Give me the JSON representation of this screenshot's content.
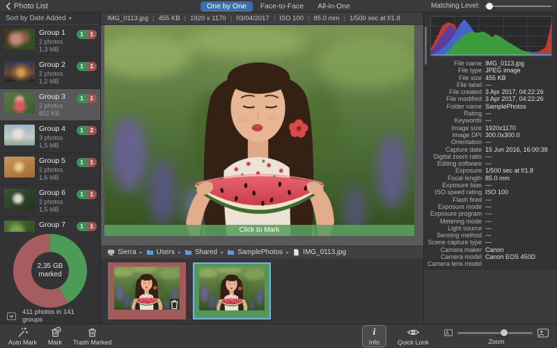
{
  "titlebar": {
    "back_label": "Photo List",
    "tabs": [
      {
        "label": "One by One",
        "active": true
      },
      {
        "label": "Face-to-Face",
        "active": false
      },
      {
        "label": "All-in-One",
        "active": false
      }
    ],
    "matching_level_label": "Matching Level:",
    "matching_level_pct": 7
  },
  "sidebar": {
    "sort_label": "Sort by Date Added",
    "groups": [
      {
        "name": "Group 1",
        "count": "2 photos",
        "size": "1,3 MB",
        "kept": "1",
        "marked": "1",
        "thumb": "g1",
        "selected": false
      },
      {
        "name": "Group 2",
        "count": "2 photos",
        "size": "1,2 MB",
        "kept": "1",
        "marked": "1",
        "thumb": "g2",
        "selected": false
      },
      {
        "name": "Group 3",
        "count": "2 photos",
        "size": "832 KB",
        "kept": "1",
        "marked": "1",
        "thumb": "g3",
        "selected": true
      },
      {
        "name": "Group 4",
        "count": "3 photos",
        "size": "1,5 MB",
        "kept": "1",
        "marked": "2",
        "thumb": "g4",
        "selected": false
      },
      {
        "name": "Group 5",
        "count": "2 photos",
        "size": "1,6 MB",
        "kept": "1",
        "marked": "1",
        "thumb": "g5",
        "selected": false
      },
      {
        "name": "Group 6",
        "count": "2 photos",
        "size": "1,5 MB",
        "kept": "1",
        "marked": "1",
        "thumb": "g6",
        "selected": false
      },
      {
        "name": "Group 7",
        "count": "",
        "size": "",
        "kept": "1",
        "marked": "1",
        "thumb": "g7",
        "selected": false
      }
    ],
    "summary": {
      "center_top": "2,35 GB",
      "center_bottom": "marked",
      "kept_pct": 42,
      "footer": "411 photos in 141 groups"
    }
  },
  "viewer": {
    "info_segments": [
      "IMG_0113.jpg",
      "455 KB",
      "1920 x 1170",
      "03/04/2017",
      "ISO 100",
      "85.0 mm",
      "1/500 sec at f/1.8"
    ],
    "click_to_mark": "Click to Mark",
    "breadcrumb": [
      {
        "icon": "computer-icon",
        "label": "Sierra"
      },
      {
        "icon": "folder-icon",
        "label": "Users"
      },
      {
        "icon": "folder-icon",
        "label": "Shared"
      },
      {
        "icon": "folder-icon",
        "label": "SamplePhotos"
      },
      {
        "icon": "file-icon",
        "label": "IMG_0113.jpg"
      }
    ]
  },
  "details": {
    "rows": [
      {
        "label": "File name",
        "value": "IMG_0113.jpg"
      },
      {
        "label": "File type",
        "value": "JPEG image"
      },
      {
        "label": "File size",
        "value": "455 KB"
      },
      {
        "label": "File label",
        "value": "---"
      },
      {
        "label": "File created",
        "value": "3 Apr 2017, 04:22:26"
      },
      {
        "label": "File modified",
        "value": "3 Apr 2017, 04:22:26"
      },
      {
        "label": "Folder name",
        "value": "SamplePhotos"
      },
      {
        "label": "Rating",
        "value": "---"
      },
      {
        "label": "Keywords",
        "value": "---"
      },
      {
        "label": "Image size",
        "value": "1920x1170"
      },
      {
        "label": "Image DPI",
        "value": "300.0x300.0"
      },
      {
        "label": "Orientation",
        "value": "---"
      },
      {
        "label": "Capture date",
        "value": "15 Jun 2016, 16:00:38"
      },
      {
        "label": "Digital zoom ratio",
        "value": "---"
      },
      {
        "label": "Editing software",
        "value": "---"
      },
      {
        "label": "Exposure",
        "value": "1/500 sec at f/1.8"
      },
      {
        "label": "Focal length",
        "value": "85.0 mm"
      },
      {
        "label": "Exposure bias",
        "value": "---"
      },
      {
        "label": "ISO speed rating",
        "value": "ISO 100"
      },
      {
        "label": "Flash fired",
        "value": "---"
      },
      {
        "label": "Exposure mode",
        "value": "---"
      },
      {
        "label": "Exposure program",
        "value": "---"
      },
      {
        "label": "Metering mode",
        "value": "---"
      },
      {
        "label": "Light source",
        "value": "---"
      },
      {
        "label": "Sensing method",
        "value": "---"
      },
      {
        "label": "Scene capture type",
        "value": "---"
      },
      {
        "label": "Camera maker",
        "value": "Canon"
      },
      {
        "label": "Camera model",
        "value": "Canon EOS 450D"
      },
      {
        "label": "Camera lens model",
        "value": ""
      }
    ]
  },
  "toolbar": {
    "auto_mark": "Auto Mark",
    "mark": "Mark",
    "trash_marked": "Trash Marked",
    "info": "Info",
    "quick_look": "Quick Look",
    "zoom": "Zoom",
    "zoom_pct": 62
  },
  "colors": {
    "accent_blue": "#3c70a8",
    "kept_green": "#4c9b57",
    "marked_red": "#a55d5d",
    "selection_blue": "#7ab2e8"
  }
}
